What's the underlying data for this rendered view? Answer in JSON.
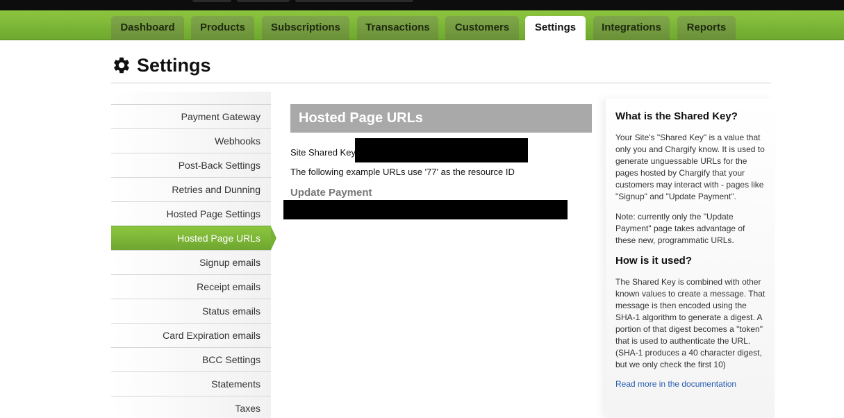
{
  "nav": {
    "tabs": [
      {
        "label": "Dashboard"
      },
      {
        "label": "Products"
      },
      {
        "label": "Subscriptions"
      },
      {
        "label": "Transactions"
      },
      {
        "label": "Customers"
      },
      {
        "label": "Settings",
        "active": true
      },
      {
        "label": "Integrations"
      },
      {
        "label": "Reports"
      }
    ]
  },
  "page": {
    "title": "Settings",
    "icon": "gear-icon"
  },
  "sidebar": {
    "items": [
      {
        "label": "Payment Gateway"
      },
      {
        "label": "Webhooks"
      },
      {
        "label": "Post-Back Settings"
      },
      {
        "label": "Retries and Dunning"
      },
      {
        "label": "Hosted Page Settings"
      },
      {
        "label": "Hosted Page URLs",
        "active": true
      },
      {
        "label": "Signup emails"
      },
      {
        "label": "Receipt emails"
      },
      {
        "label": "Status emails"
      },
      {
        "label": "Card Expiration emails"
      },
      {
        "label": "BCC Settings"
      },
      {
        "label": "Statements"
      },
      {
        "label": "Taxes"
      }
    ]
  },
  "main": {
    "header": "Hosted Page URLs",
    "shared_key_label": "Site Shared Key:",
    "example_note": "The following example URLs use '77' as the resource ID",
    "update_payment_heading": "Update Payment"
  },
  "help": {
    "q1": "What is the Shared Key?",
    "p1": "Your Site's \"Shared Key\" is a value that only you and Chargify know. It is used to generate unguessable URLs for the pages hosted by Chargify that your customers may interact with - pages like \"Signup\" and \"Update Payment\".",
    "p2": "Note: currently only the \"Update Payment\" page takes advantage of these new, programmatic URLs.",
    "q2": "How is it used?",
    "p3": "The Shared Key is combined with other known values to create a message. That message is then encoded using the SHA-1 algorithm to generate a digest. A portion of that digest becomes a \"token\" that is used to authenticate the URL. (SHA-1 produces a 40 character digest, but we only check the first 10)",
    "link": "Read more in the documentation"
  },
  "colors": {
    "nav_green": "#8cc63f",
    "header_gray": "#a9a9a9",
    "link_blue": "#2a5db0"
  }
}
